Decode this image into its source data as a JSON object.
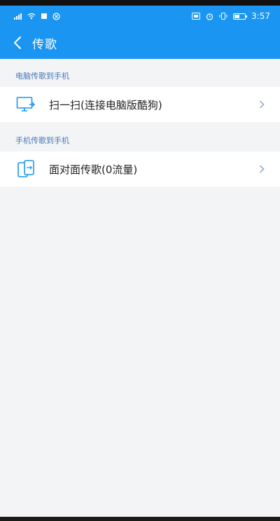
{
  "status_bar": {
    "time": "3:57",
    "icons": [
      "signal-icon",
      "wifi-icon",
      "notification-icon",
      "blocked-icon",
      "hd-icon",
      "alarm-icon",
      "vibrate-icon",
      "battery-icon"
    ]
  },
  "app_bar": {
    "title": "传歌",
    "back_icon": "chevron-left-icon"
  },
  "sections": [
    {
      "label": "电脑传歌到手机",
      "item": {
        "label": "扫一扫(连接电脑版酷狗)",
        "icon": "monitor-icon"
      }
    },
    {
      "label": "手机传歌到手机",
      "item": {
        "label": "面对面传歌(0流量)",
        "icon": "phone-transfer-icon"
      }
    }
  ],
  "colors": {
    "primary": "#1a96f2",
    "background": "#f3f4f6",
    "section_label": "#4a78b8",
    "icon": "#1a96f2",
    "chevron": "#8aa6c8"
  }
}
